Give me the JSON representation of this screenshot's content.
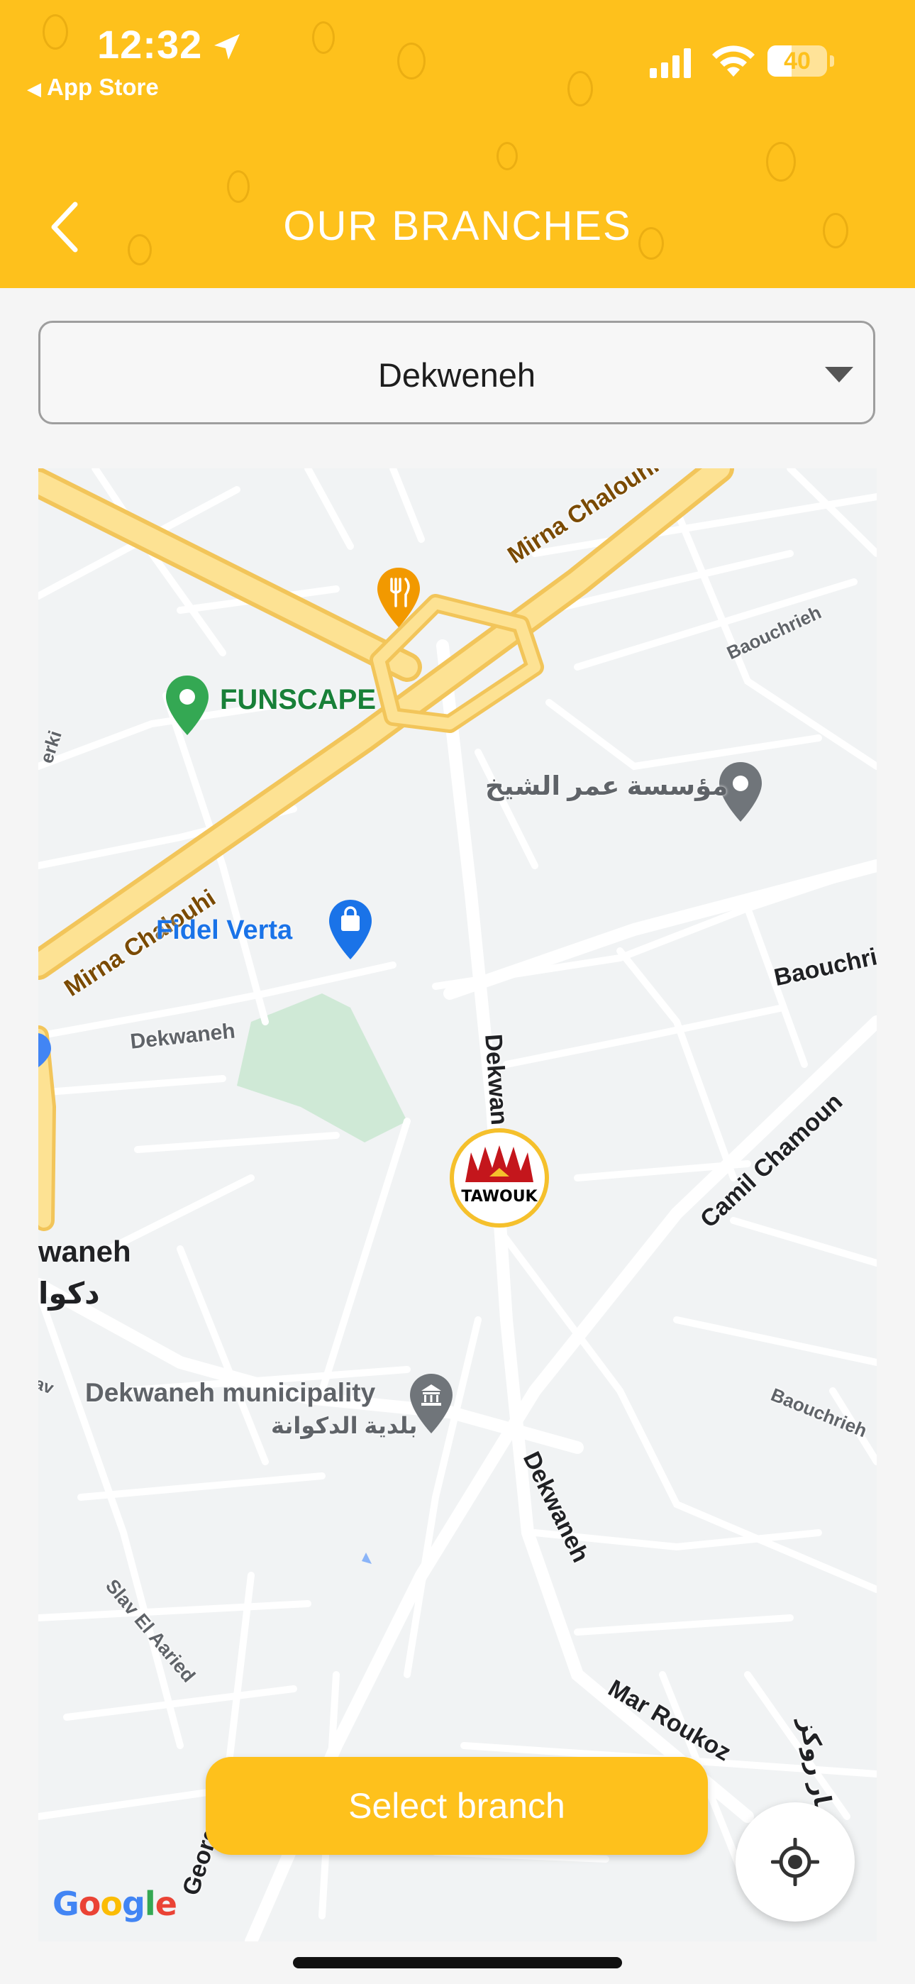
{
  "status_bar": {
    "time": "12:32",
    "back_app": "App Store",
    "battery_level": "40"
  },
  "header": {
    "title": "OUR BRANCHES",
    "background_color": "#fec11c"
  },
  "branch_select": {
    "selected": "Dekweneh"
  },
  "map": {
    "labels": {
      "mirna_chalouhi_top": "Mirna Chalouhi",
      "mirna_chalouhi_bottom": "Mirna Chalouhi",
      "baouchrieh_top": "Baouchrieh",
      "baouchrieh_mid": "Baouchrie",
      "baouchrieh_bottom": "Baouchrieh",
      "funscape": "FUNSCAPE",
      "omar_sheikh": "مؤسسة عمر الشيخ",
      "fidel_verta": "Fidel Verta",
      "dekwaneh_left": "Dekwaneh",
      "dekwan_vertical": "Dekwan",
      "camil_chamoun": "Camil Chamoun",
      "waneh": "waneh",
      "dekwaneh_arabic_left": "دكوا",
      "municipality": "Dekwaneh municipality",
      "municipality_arabic": "بلدية الدكوانة",
      "dekwaneh_lower": "Dekwaneh",
      "slav_el_aaried": "Slav El Aaried",
      "mar_roukoz": "Mar Roukoz",
      "mar_roukoz_arabic": "مار روكز",
      "erki": "erki",
      "georg": "Georg",
      "av": "av"
    },
    "branch_logo_text": "TAWOUK",
    "attribution": "Google"
  },
  "actions": {
    "select_branch": "Select branch"
  },
  "icons": {
    "back": "chevron-left-icon",
    "dropdown": "caret-down-icon",
    "locate": "my-location-icon",
    "restaurant_pin": "fork-knife-pin-icon",
    "shopping_pin": "shopping-bag-pin-icon",
    "landmark_pin": "municipality-pin-icon"
  }
}
